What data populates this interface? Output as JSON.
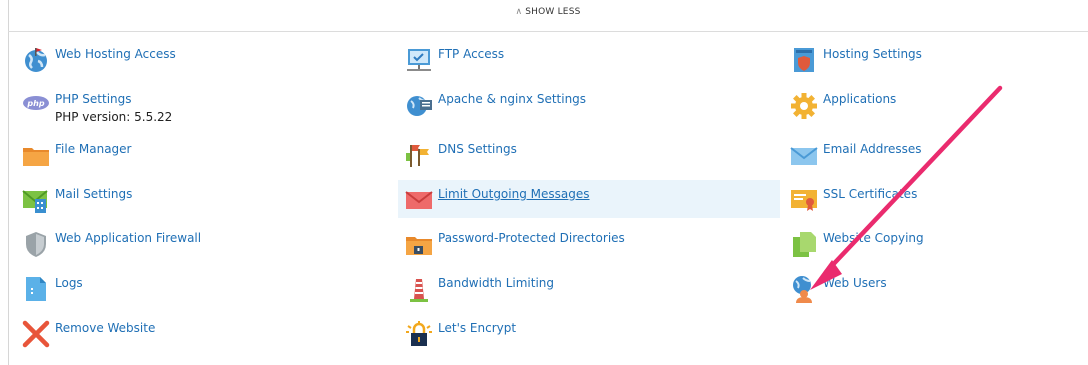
{
  "toggle": {
    "label": "SHOW LESS",
    "icon": "chevron-up-icon"
  },
  "col1": [
    {
      "label": "Web Hosting Access",
      "icon": "globe-icon"
    },
    {
      "label": "PHP Settings",
      "icon": "php-icon",
      "sub": "PHP version: 5.5.22"
    },
    {
      "label": "File Manager",
      "icon": "folder-icon"
    },
    {
      "label": "Mail Settings",
      "icon": "mail-settings-icon"
    },
    {
      "label": "Web Application Firewall",
      "icon": "shield-icon"
    },
    {
      "label": "Logs",
      "icon": "log-file-icon"
    },
    {
      "label": "Remove Website",
      "icon": "remove-x-icon"
    }
  ],
  "col2": [
    {
      "label": "FTP Access",
      "icon": "ftp-icon"
    },
    {
      "label": "Apache & nginx Settings",
      "icon": "apache-globe-icon"
    },
    {
      "label": "DNS Settings",
      "icon": "dns-flags-icon"
    },
    {
      "label": "Limit Outgoing Messages",
      "icon": "red-envelope-icon"
    },
    {
      "label": "Password-Protected Directories",
      "icon": "locked-folder-icon"
    },
    {
      "label": "Bandwidth Limiting",
      "icon": "bandwidth-tower-icon"
    },
    {
      "label": "Let's Encrypt",
      "icon": "lets-encrypt-lock-icon"
    }
  ],
  "col3": [
    {
      "label": "Hosting Settings",
      "icon": "hosting-settings-icon"
    },
    {
      "label": "Applications",
      "icon": "gear-icon"
    },
    {
      "label": "Email Addresses",
      "icon": "envelope-icon"
    },
    {
      "label": "SSL Certificates",
      "icon": "certificate-icon"
    },
    {
      "label": "Website Copying",
      "icon": "copy-pages-icon"
    },
    {
      "label": "Web Users",
      "icon": "web-users-icon"
    }
  ],
  "annotation": {
    "arrow_color": "#ea2b6e"
  }
}
